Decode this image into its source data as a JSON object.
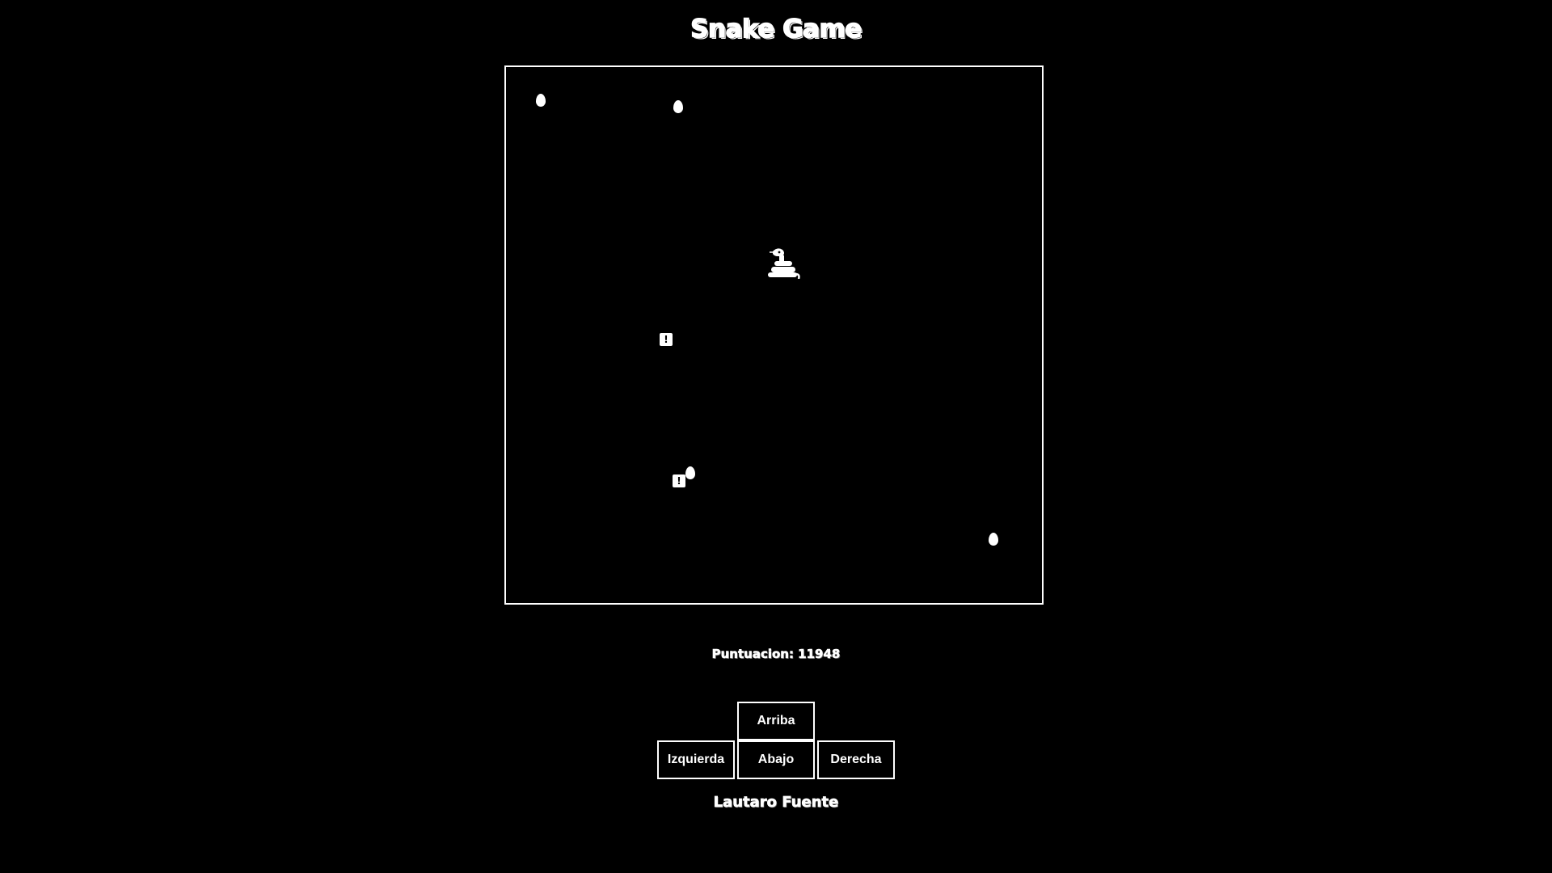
{
  "header": {
    "title": "Snake Game"
  },
  "board": {
    "border_color": "#ffffff",
    "background": "#000000",
    "items": [
      {
        "kind": "egg",
        "icon": "egg-icon"
      },
      {
        "kind": "egg",
        "icon": "egg-icon"
      },
      {
        "kind": "egg",
        "icon": "egg-icon"
      },
      {
        "kind": "egg",
        "icon": "egg-icon"
      },
      {
        "kind": "trap",
        "icon": "warning-block-icon",
        "symbol": "!"
      },
      {
        "kind": "trap",
        "icon": "warning-block-icon",
        "symbol": "!"
      },
      {
        "kind": "snake",
        "icon": "coiled-snake-icon"
      }
    ]
  },
  "score": {
    "label": "Puntuacion: 11948"
  },
  "controls": {
    "up": "Arriba",
    "left": "Izquierda",
    "down": "Abajo",
    "right": "Derecha"
  },
  "footer": {
    "author": "Lautaro Fuente"
  }
}
